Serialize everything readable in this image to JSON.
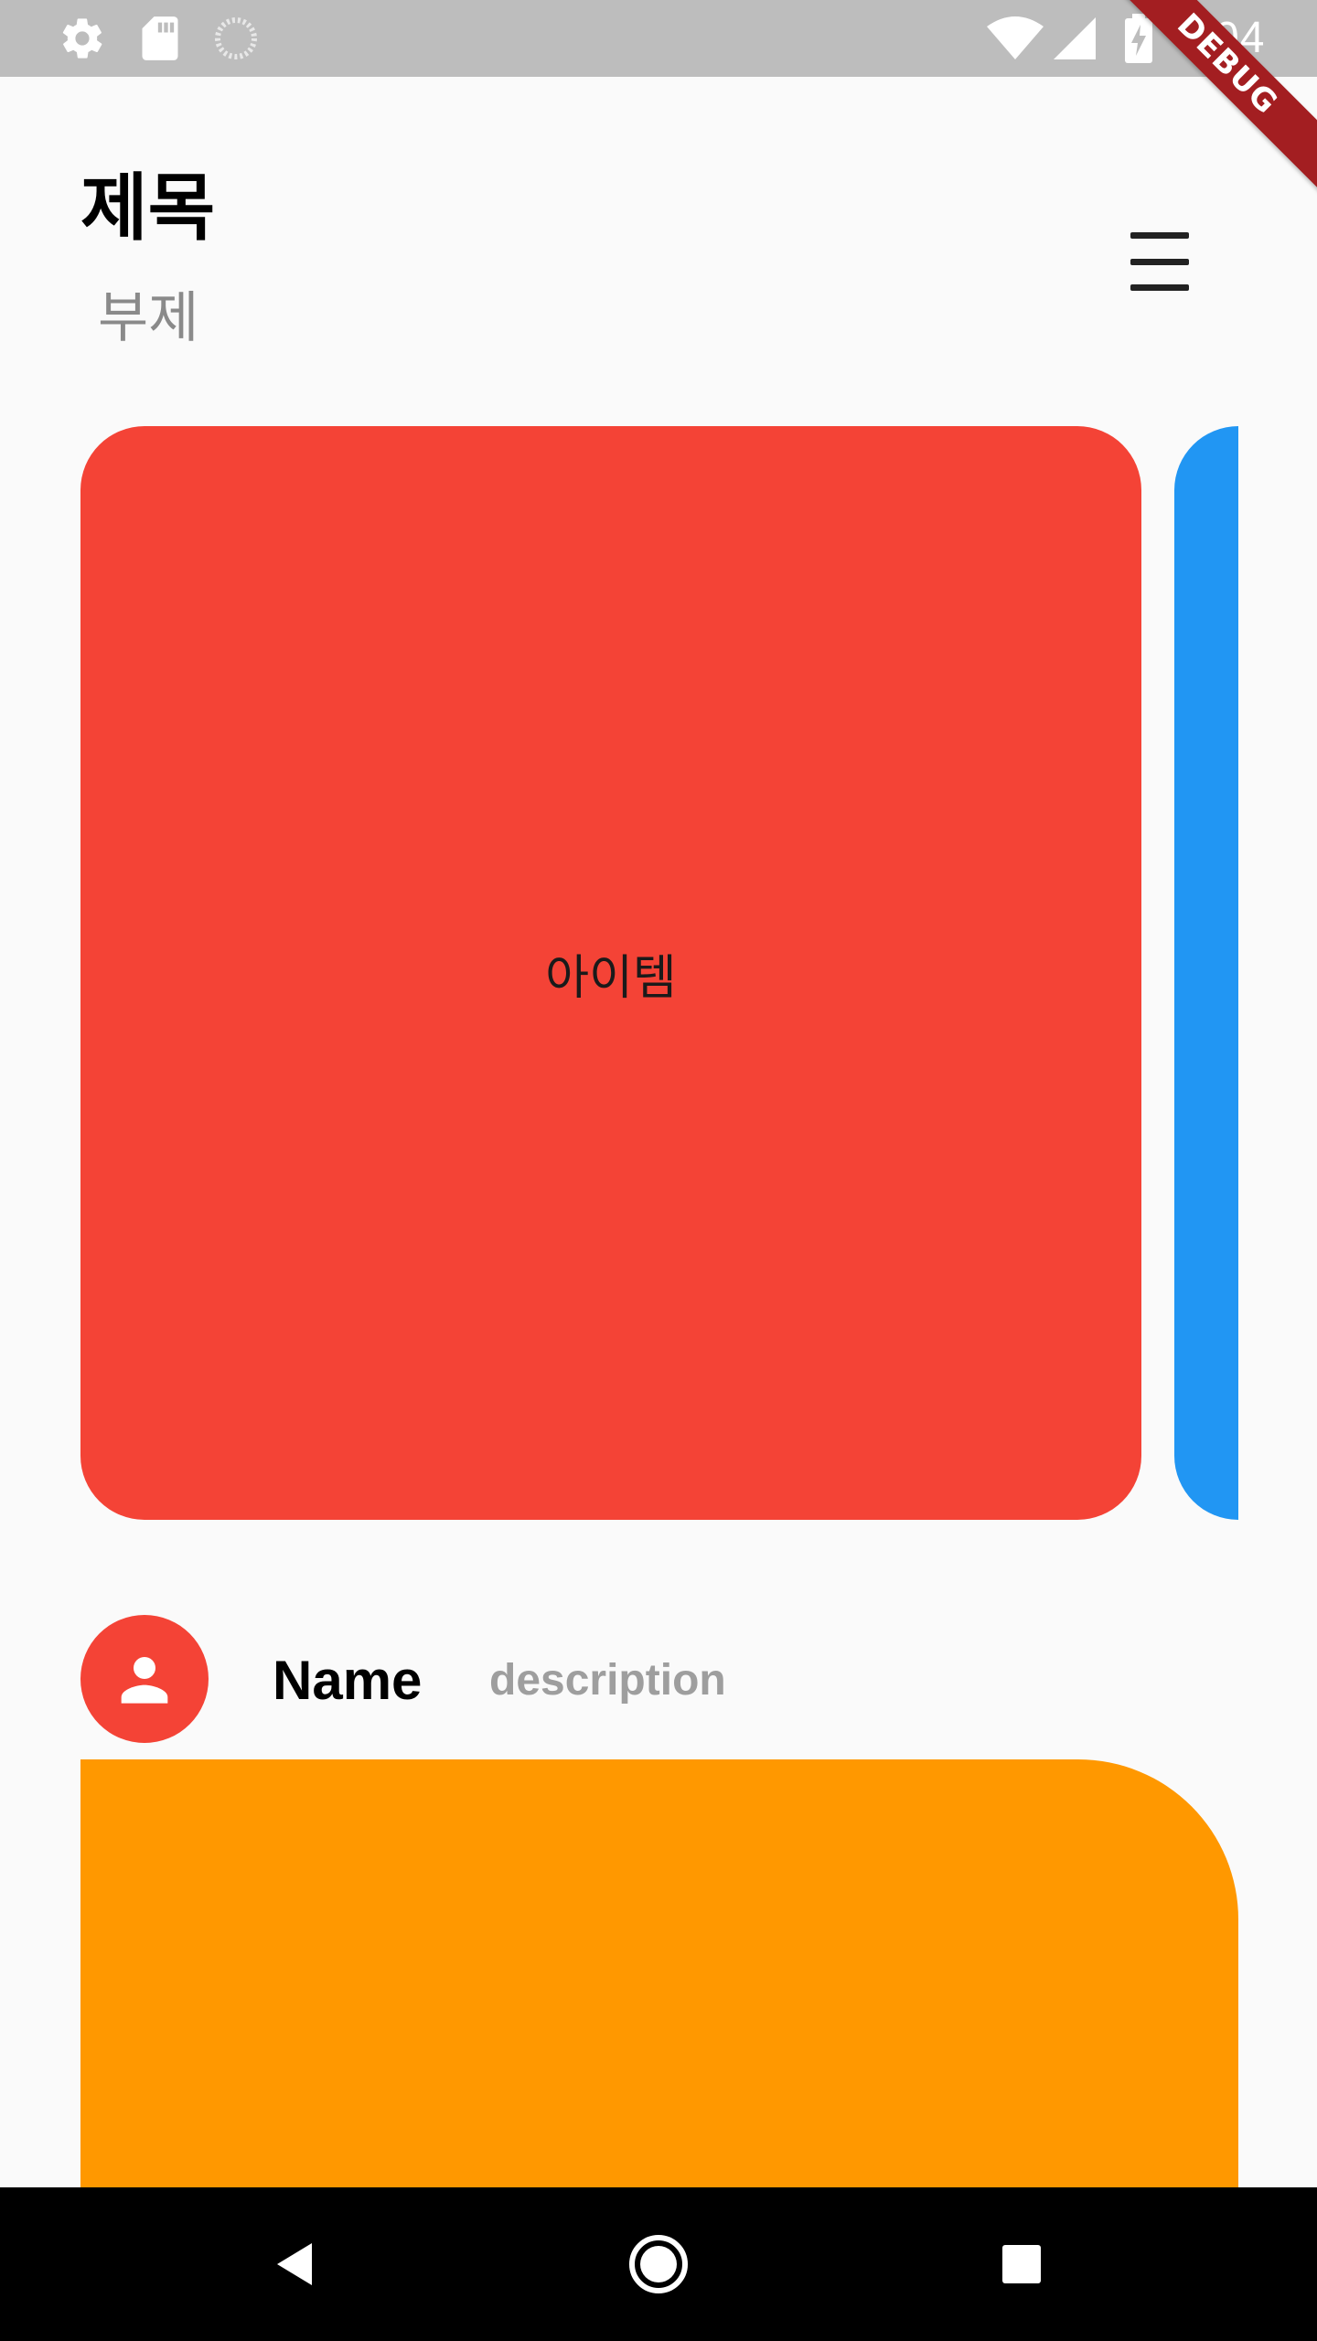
{
  "status_bar": {
    "time": "8:04",
    "icons": [
      "gear-icon",
      "sd-card-icon",
      "spinner-icon",
      "wifi-icon",
      "cell-signal-icon",
      "battery-charging-icon"
    ]
  },
  "debug_banner": {
    "label": "DEBUG",
    "color": "#a31e21"
  },
  "header": {
    "title": "제목",
    "subtitle": "부제",
    "menu_icon": "hamburger-menu-icon"
  },
  "carousel": {
    "items": [
      {
        "label": "아이템",
        "color": "#f44336"
      },
      {
        "label": "",
        "color": "#2196f3"
      }
    ]
  },
  "profile": {
    "avatar_icon": "person-icon",
    "avatar_color": "#f44336",
    "name": "Name",
    "description": "description"
  },
  "content_card": {
    "color": "#ff9800"
  },
  "nav_bar": {
    "buttons": [
      "back-icon",
      "home-icon",
      "recents-icon"
    ]
  }
}
